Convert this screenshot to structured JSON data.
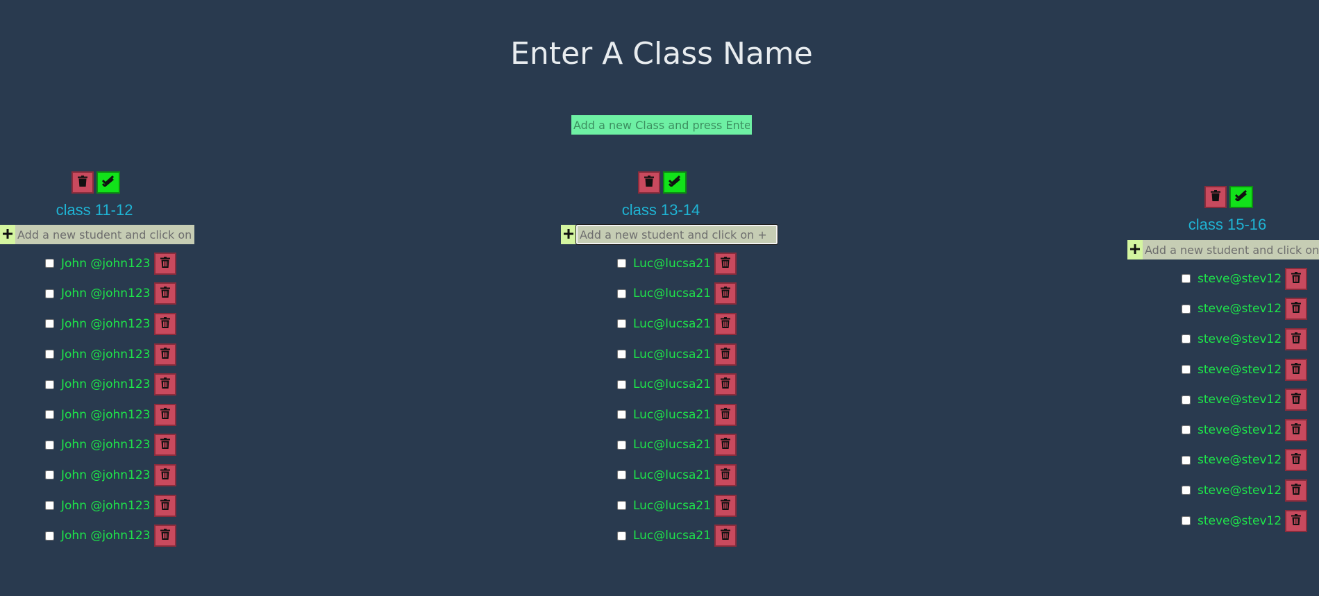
{
  "header": {
    "title": "Enter A Class Name",
    "class_input_placeholder": "Add a new Class and press Enter"
  },
  "icons": {
    "delete": "trash-icon",
    "complete": "double-check-icon",
    "add": "plus-icon"
  },
  "colors": {
    "background": "#293a4f",
    "class_title": "#1fb4d4",
    "student_text": "#1ee64a",
    "delete_button": "#c84a5e",
    "complete_button": "#12e21a"
  },
  "classes": [
    {
      "name": "class 11-12",
      "student_input_placeholder": "Add a new student and click on +",
      "students": [
        "John @john123",
        "John @john123",
        "John @john123",
        "John @john123",
        "John @john123",
        "John @john123",
        "John @john123",
        "John @john123",
        "John @john123",
        "John @john123"
      ]
    },
    {
      "name": "class 13-14",
      "student_input_placeholder": "Add a new student and click on +",
      "students": [
        "Luc@lucsa21",
        "Luc@lucsa21",
        "Luc@lucsa21",
        "Luc@lucsa21",
        "Luc@lucsa21",
        "Luc@lucsa21",
        "Luc@lucsa21",
        "Luc@lucsa21",
        "Luc@lucsa21",
        "Luc@lucsa21"
      ]
    },
    {
      "name": "class 15-16",
      "student_input_placeholder": "Add a new student and click on +",
      "students": [
        "steve@stev12",
        "steve@stev12",
        "steve@stev12",
        "steve@stev12",
        "steve@stev12",
        "steve@stev12",
        "steve@stev12",
        "steve@stev12",
        "steve@stev12"
      ]
    }
  ]
}
